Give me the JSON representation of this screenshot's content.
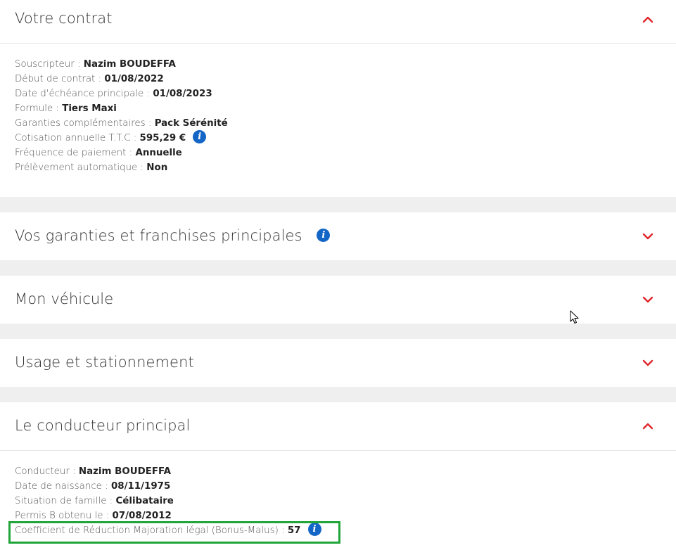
{
  "contract": {
    "title": "Votre contrat",
    "rows": [
      {
        "label": "Souscripteur : ",
        "value": "Nazim BOUDEFFA"
      },
      {
        "label": "Début de contrat : ",
        "value": "01/08/2022"
      },
      {
        "label": "Date d'échéance principale : ",
        "value": "01/08/2023"
      },
      {
        "label": "Formule : ",
        "value": "Tiers Maxi"
      },
      {
        "label": "Garanties complémentaires : ",
        "value": "Pack Sérénité"
      },
      {
        "label": "Cotisation annuelle T.T.C : ",
        "value": "595,29 €"
      },
      {
        "label": "Fréquence de paiement : ",
        "value": "Annuelle"
      },
      {
        "label": "Prélèvement automatique : ",
        "value": "Non"
      }
    ]
  },
  "guarantees": {
    "title": "Vos garanties et franchises principales"
  },
  "vehicle": {
    "title": "Mon véhicule"
  },
  "usage": {
    "title": "Usage et stationnement"
  },
  "driver": {
    "title": "Le conducteur principal",
    "rows": [
      {
        "label": "Conducteur : ",
        "value": "Nazim BOUDEFFA"
      },
      {
        "label": "Date de naissance : ",
        "value": "08/11/1975"
      },
      {
        "label": "Situation de famille : ",
        "value": "Célibataire"
      },
      {
        "label": "Permis B obtenu le : ",
        "value": "07/08/2012"
      },
      {
        "label": "Coefficient de Réduction Majoration légal (Bonus-Malus) : ",
        "value": "57"
      }
    ]
  },
  "icons": {
    "info": "i",
    "expand": "chevron-down-icon",
    "collapse": "chevron-up-icon"
  },
  "colors": {
    "accent": "#e0252b",
    "info": "#1466c6",
    "highlight": "#20a53a",
    "background": "#efefef"
  }
}
